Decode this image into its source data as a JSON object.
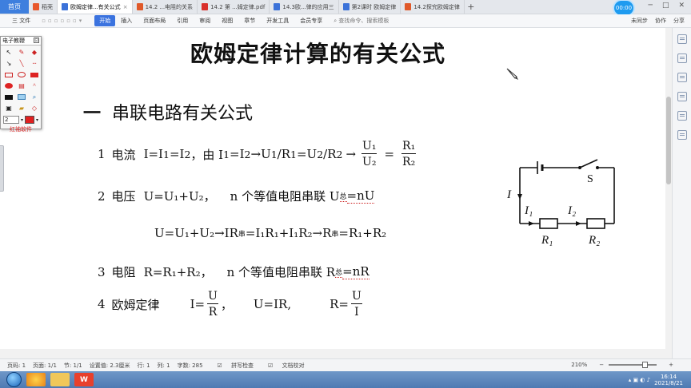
{
  "tabs": {
    "home": "首页",
    "items": [
      {
        "label": "稻壳",
        "icon": "s"
      },
      {
        "label": "欧姆定律...有关公式",
        "icon": "w",
        "active": true
      },
      {
        "label": "14.2 ...电阻的关系",
        "icon": "p"
      },
      {
        "label": "14.2 第 ...姆定律.pdf",
        "icon": "pdf"
      },
      {
        "label": "14.3欧...律的应用三",
        "icon": "w"
      },
      {
        "label": "第2课时 欧姆定律",
        "icon": "w"
      },
      {
        "label": "14.2探究欧姆定律",
        "icon": "p"
      }
    ],
    "add": "+",
    "clock": "00:00"
  },
  "menu": {
    "file": "三 文件",
    "items": [
      "开始",
      "插入",
      "页面布局",
      "引用",
      "审阅",
      "视图",
      "章节",
      "开发工具",
      "会员专享",
      "查找命令、搜索模板"
    ],
    "right": [
      "未同步",
      "协作",
      "分享"
    ]
  },
  "palette": {
    "title": "电子教鞭",
    "pin": "⊡",
    "size": "2",
    "brand": "红袖软件"
  },
  "doc": {
    "title": "欧姆定律计算的有关公式",
    "section_dash": "一",
    "section": "串联电路有关公式",
    "l1_num": "1",
    "l1_lbl": "电流",
    "l1_a": "I=I",
    "l1_a_s1": "1",
    "l1_b": "=I",
    "l1_b_s2": "2",
    "l1_c": "，由 I",
    "l1_d": "=I",
    "l1_e": "→U",
    "l1_f": "/R",
    "l1_g": "=U",
    "l1_h": "/R",
    "l1_arrow": "→",
    "frac1_n": "U₁",
    "frac1_d": "U₂",
    "eq": "=",
    "frac2_n": "R₁",
    "frac2_d": "R₂",
    "l2_num": "2",
    "l2_lbl": "电压",
    "l2_a": "U=U₁+U₂，",
    "l2_b": "n 个等值电阻串联 U",
    "l2_sub": "总",
    "l2_c": "=nU",
    "l2x": "U=U₁+U₂→IR",
    "l2x_sub": "串",
    "l2x_b": "=I₁R₁+I₁R₂→R",
    "l2x_sub2": "串",
    "l2x_c": "=R₁+R₂",
    "l3_num": "3",
    "l3_lbl": "电阻",
    "l3_a": "R=R₁+R₂，",
    "l3_b": "n 个等值电阻串联 R",
    "l3_sub": "总",
    "l3_c": "=nR",
    "l4_num": "4",
    "l4_lbl": "欧姆定律",
    "l4_i": "I=",
    "l4_f1n": "U",
    "l4_f1d": "R",
    "l4_comma": "，",
    "l4_u": "U=IR,",
    "l4_r": "R=",
    "l4_f2n": "U",
    "l4_f2d": "I"
  },
  "circuit": {
    "I": "I",
    "I1": "I₁",
    "I2": "I₂",
    "R1": "R₁",
    "R2": "R₂",
    "S": "S"
  },
  "status": {
    "items": [
      "页码: 1",
      "页面: 1/1",
      "节: 1/1",
      "设置值: 2.3厘米",
      "行: 1",
      "列: 1",
      "字数: 285",
      "拼写检查",
      "文档校对"
    ],
    "zoom": "210%"
  },
  "taskbar": {
    "time": "16:14",
    "date": "2021/8/21"
  }
}
